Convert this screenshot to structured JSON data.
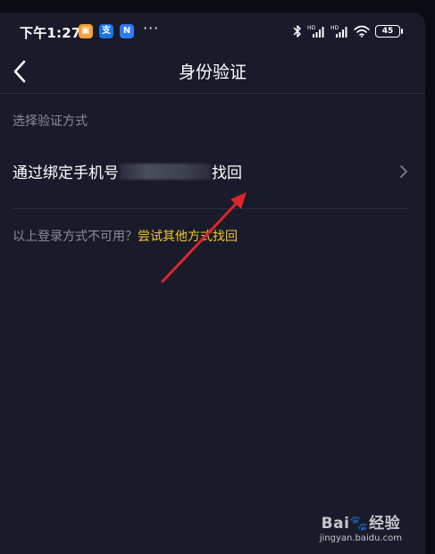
{
  "status_bar": {
    "time": "下午1:27",
    "app_icon_2_glyph": "支",
    "app_icon_3_glyph": "N",
    "overflow": "···",
    "battery": "45"
  },
  "header": {
    "title": "身份验证"
  },
  "section": {
    "label": "选择验证方式"
  },
  "option": {
    "label_start": "通过绑定手机号",
    "label_end": "找回"
  },
  "alternative": {
    "prefix": "以上登录方式不可用？",
    "link": "尝试其他方式找回"
  },
  "colors": {
    "background": "#191b2a",
    "link": "#f4c430",
    "annotation_arrow": "#d9262c"
  },
  "watermark": {
    "logo": "Bai🐾经验",
    "url": "jingyan.baidu.com"
  }
}
